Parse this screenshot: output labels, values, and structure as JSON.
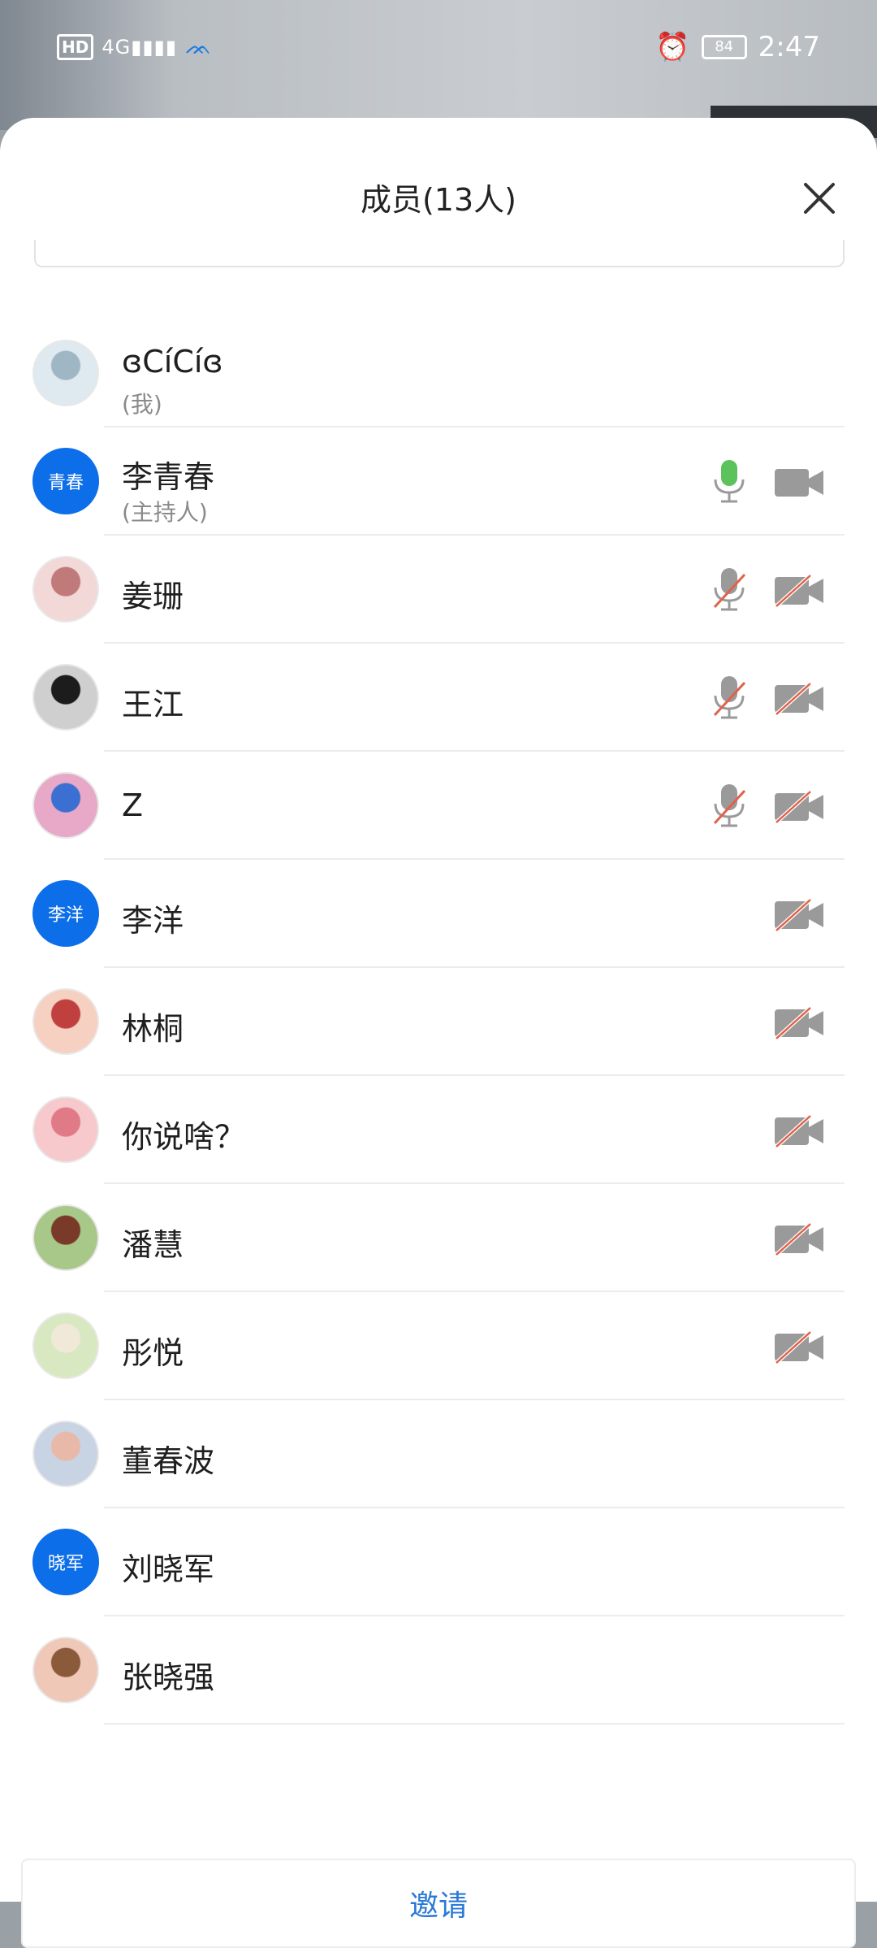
{
  "status_bar": {
    "hd_label": "HD",
    "network_label": "4G",
    "battery_level": "84",
    "time": "2:47"
  },
  "sheet": {
    "title": "成员(13人)",
    "invite_label": "邀请"
  },
  "members": [
    {
      "name": "ɞCíCíɞ",
      "role": "(我)",
      "avatar_type": "photo",
      "avatar_colors": [
        "#dfe9f0",
        "#9fb6c4"
      ],
      "mic": "none",
      "cam": "none"
    },
    {
      "name": "李青春",
      "role": "(主持人)",
      "avatar_type": "text",
      "avatar_text": "青春",
      "mic": "on",
      "cam": "on"
    },
    {
      "name": "姜珊",
      "role": "",
      "avatar_type": "photo",
      "avatar_colors": [
        "#f3d8d8",
        "#c07a7a"
      ],
      "mic": "off",
      "cam": "off"
    },
    {
      "name": "王江",
      "role": "",
      "avatar_type": "photo",
      "avatar_colors": [
        "#cfcfcf",
        "#1c1c1c"
      ],
      "mic": "off",
      "cam": "off"
    },
    {
      "name": "Z",
      "role": "",
      "avatar_type": "photo",
      "avatar_colors": [
        "#e8a8c8",
        "#3b6fd1"
      ],
      "mic": "off",
      "cam": "off"
    },
    {
      "name": "李洋",
      "role": "",
      "avatar_type": "text",
      "avatar_text": "李洋",
      "mic": "none",
      "cam": "off"
    },
    {
      "name": "林桐",
      "role": "",
      "avatar_type": "photo",
      "avatar_colors": [
        "#f6d0c0",
        "#c04040"
      ],
      "mic": "none",
      "cam": "off"
    },
    {
      "name": "你说啥？",
      "role": "",
      "avatar_type": "photo",
      "avatar_colors": [
        "#f7c8cc",
        "#e07a86"
      ],
      "mic": "none",
      "cam": "off"
    },
    {
      "name": "潘慧",
      "role": "",
      "avatar_type": "photo",
      "avatar_colors": [
        "#a8c88a",
        "#7a3a2a"
      ],
      "mic": "none",
      "cam": "off"
    },
    {
      "name": "彤悦",
      "role": "",
      "avatar_type": "photo",
      "avatar_colors": [
        "#d8e8c0",
        "#f0e8d8"
      ],
      "mic": "none",
      "cam": "off"
    },
    {
      "name": "董春波",
      "role": "",
      "avatar_type": "photo",
      "avatar_colors": [
        "#c8d4e4",
        "#e8b8a8"
      ],
      "mic": "none",
      "cam": "none"
    },
    {
      "name": "刘晓军",
      "role": "",
      "avatar_type": "text",
      "avatar_text": "晓军",
      "mic": "none",
      "cam": "none"
    },
    {
      "name": "张晓强",
      "role": "",
      "avatar_type": "photo",
      "avatar_colors": [
        "#f0c8b8",
        "#8a5a3a"
      ],
      "mic": "none",
      "cam": "none"
    }
  ],
  "colors": {
    "accent_blue": "#0c6ee8",
    "mic_on": "#5cc25c",
    "icon_gray": "#9a9a9a",
    "muted_slash": "#e0624a",
    "invite_text": "#2a78d6"
  }
}
